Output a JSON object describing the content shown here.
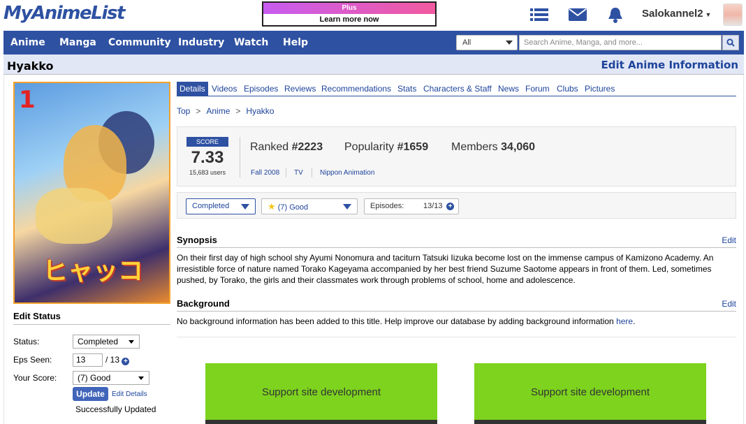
{
  "header": {
    "logo": "MyAnimeList",
    "banner_top": "Plus",
    "banner_bottom": "Learn more now",
    "username": "Salokannel2"
  },
  "nav": {
    "items": [
      "Anime",
      "Manga",
      "Community",
      "Industry",
      "Watch",
      "Help"
    ],
    "search_category": "All",
    "search_placeholder": "Search Anime, Manga, and more..."
  },
  "title": {
    "name": "Hyakko",
    "edit_link": "Edit Anime Information"
  },
  "cover": {
    "number": "1",
    "logo_text": "ヒャッコ"
  },
  "edit_status": {
    "heading": "Edit Status",
    "status_label": "Status:",
    "status_value": "Completed",
    "eps_label": "Eps Seen:",
    "eps_value": "13",
    "eps_total": "/ 13",
    "score_label": "Your Score:",
    "score_value": "(7) Good",
    "update_button": "Update",
    "edit_details": "Edit Details",
    "message": "Successfully Updated"
  },
  "tabs": [
    "Details",
    "Videos",
    "Episodes",
    "Reviews",
    "Recommendations",
    "Stats",
    "Characters & Staff",
    "News",
    "Forum",
    "Clubs",
    "Pictures"
  ],
  "breadcrumb": [
    "Top",
    "Anime",
    "Hyakko"
  ],
  "stats": {
    "score_label": "SCORE",
    "score": "7.33",
    "users": "15,683 users",
    "ranked_label": "Ranked",
    "ranked": "#2223",
    "popularity_label": "Popularity",
    "popularity": "#1659",
    "members_label": "Members",
    "members": "34,060",
    "season": "Fall 2008",
    "type": "TV",
    "studio": "Nippon Animation"
  },
  "list_bar": {
    "status": "Completed",
    "score": "(7) Good",
    "episodes_label": "Episodes:",
    "episodes": "13/13"
  },
  "synopsis": {
    "heading": "Synopsis",
    "edit": "Edit",
    "text": "On their first day of high school shy Ayumi Nonomura and taciturn Tatsuki Iizuka become lost on the immense campus of Kamizono Academy. An irresistible force of nature named Torako Kageyama accompanied by her best friend Suzume Saotome appears in front of them. Led, sometimes pushed, by Torako, the girls and their classmates work through problems of school, home and adolescence."
  },
  "background": {
    "heading": "Background",
    "edit": "Edit",
    "text": "No background information has been added to this title. Help improve our database by adding background information ",
    "link": "here",
    "tail": "."
  },
  "promos": [
    "Support site development",
    "Support site development"
  ],
  "colors": {
    "brand": "#2e51a2",
    "promo_green": "#7dd31e",
    "cover_border": "#f3a12a"
  }
}
